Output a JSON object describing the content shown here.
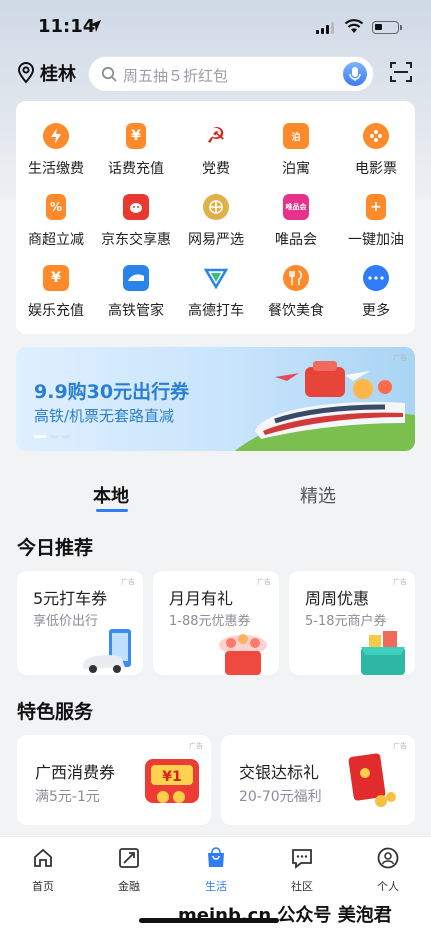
{
  "status_bar": {
    "time": "11:14"
  },
  "header": {
    "city": "桂林",
    "search_placeholder": "周五抽５折红包"
  },
  "services": [
    {
      "label": "生活缴费",
      "icon": "lightning-icon",
      "color": "#ff8a2b"
    },
    {
      "label": "话费充值",
      "icon": "yuan-phone-icon",
      "color": "#ff8a2b"
    },
    {
      "label": "党费",
      "icon": "party-emblem-icon",
      "color": "#d9261c"
    },
    {
      "label": "泊寓",
      "icon": "boyu-icon",
      "color": "#ff8a2b"
    },
    {
      "label": "电影票",
      "icon": "film-reel-icon",
      "color": "#ff8a2b"
    },
    {
      "label": "商超立减",
      "icon": "percent-icon",
      "color": "#ff8a2b"
    },
    {
      "label": "京东交享惠",
      "icon": "jd-icon",
      "color": "#e8382f"
    },
    {
      "label": "网易严选",
      "icon": "yanxuan-icon",
      "color": "#e0b04a"
    },
    {
      "label": "唯品会",
      "icon": "vip-icon",
      "color": "#e6328a"
    },
    {
      "label": "一键加油",
      "icon": "fuel-icon",
      "color": "#ff8a2b"
    },
    {
      "label": "娱乐充值",
      "icon": "yuan-card-icon",
      "color": "#ff8a2b"
    },
    {
      "label": "高铁管家",
      "icon": "train-icon",
      "color": "#2a83e8"
    },
    {
      "label": "高德打车",
      "icon": "amap-icon",
      "color": "#2a83e8"
    },
    {
      "label": "餐饮美食",
      "icon": "fork-knife-icon",
      "color": "#ff8a2b"
    },
    {
      "label": "更多",
      "icon": "more-icon",
      "color": "#2e7cf6"
    }
  ],
  "banner": {
    "title": "9.9购30元出行券",
    "subtitle": "高铁/机票无套路直减",
    "ad": "广告"
  },
  "tabs": {
    "local": "本地",
    "selected": "精选"
  },
  "today": {
    "title": "今日推荐",
    "cards": [
      {
        "title": "5元打车券",
        "subtitle": "享低价出行",
        "ad": "广告"
      },
      {
        "title": "月月有礼",
        "subtitle": "1-88元优惠券",
        "ad": "广告"
      },
      {
        "title": "周周优惠",
        "subtitle": "5-18元商户券",
        "ad": "广告"
      }
    ]
  },
  "special": {
    "title": "特色服务",
    "cards": [
      {
        "title": "广西消费券",
        "subtitle": "满5元-1元",
        "ad": "广告"
      },
      {
        "title": "交银达标礼",
        "subtitle": "20-70元福利",
        "ad": "广告"
      }
    ]
  },
  "tabbar": [
    {
      "label": "首页",
      "icon": "home-icon"
    },
    {
      "label": "金融",
      "icon": "finance-icon"
    },
    {
      "label": "生活",
      "icon": "shopping-bag-icon",
      "active": true
    },
    {
      "label": "社区",
      "icon": "chat-icon"
    },
    {
      "label": "个人",
      "icon": "person-icon"
    }
  ],
  "watermark": "meinb.cn 公众号 美泡君",
  "colors": {
    "accent": "#2e7cf6",
    "orange": "#ff8a2b"
  }
}
